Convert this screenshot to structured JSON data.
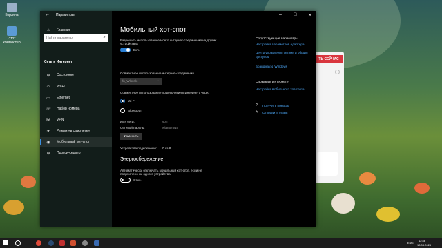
{
  "desktop": {
    "icons": [
      {
        "label": "Корзина",
        "color": "#9ab0c8"
      },
      {
        "label": "Этот компьютер",
        "color": "#5b9bd5"
      }
    ]
  },
  "background_window": {
    "button_label": "ТЬ СЕЙЧАС"
  },
  "window": {
    "title": "Параметры",
    "back_glyph": "←",
    "minimize_glyph": "–",
    "maximize_glyph": "□",
    "close_glyph": "✕"
  },
  "sidebar": {
    "home": "Главная",
    "search_placeholder": "Найти параметр",
    "section_header": "Сеть и Интернет",
    "items": [
      {
        "label": "Состояние",
        "icon": "⊕",
        "active": false
      },
      {
        "label": "Wi-Fi",
        "icon": "◠",
        "active": false
      },
      {
        "label": "Ethernet",
        "icon": "▭",
        "active": false
      },
      {
        "label": "Набор номера",
        "icon": "☏",
        "active": false
      },
      {
        "label": "VPN",
        "icon": "⋈",
        "active": false
      },
      {
        "label": "Режим «в самолете»",
        "icon": "✈",
        "active": false
      },
      {
        "label": "Мобильный хот-спот",
        "icon": "◉",
        "active": true
      },
      {
        "label": "Прокси-сервер",
        "icon": "⊕",
        "active": false
      }
    ]
  },
  "main": {
    "title": "Мобильный хот-спот",
    "share_desc_line1": "Разрешить использование моего интернет-соединения на других",
    "share_desc_line2": "устройствах",
    "share_toggle_label": "Вкл.",
    "share_from_label": "Совместное использование интернет-соединения",
    "share_from_value": "fn_Wlsuslo",
    "share_over_label": "Совместное использование подключения к Интернету через",
    "radio_wifi": "Wi-Fi",
    "radio_bluetooth": "Bluetooth",
    "network_name_label": "Имя сети:",
    "network_name_value": "vpn",
    "network_password_label": "Сетевой пароль:",
    "network_password_value": "wlan675w3",
    "change_button": "Изменить",
    "connected_label": "Устройства подключены:",
    "connected_value": "0 из 8",
    "power_section_title": "Энергосбережение",
    "power_desc_line1": "Автоматически отключать мобильный хот-спот, если не",
    "power_desc_line2": "подключено ни одного устройства.",
    "power_toggle_label": "Откл."
  },
  "right_panel": {
    "related_header": "Сопутствующие параметры",
    "links": [
      "Настройка параметров адаптера",
      "Центр управления сетями и общим",
      "доступом",
      "Брандмауэр Windows"
    ],
    "help_header": "Справка в Интернете",
    "help_link": "Настройка мобильного хот-спота",
    "get_help": "Получить помощь",
    "feedback": "Отправить отзыв"
  },
  "taskbar": {
    "time": "12:46",
    "date": "13.08.2024",
    "lang": "ENG"
  },
  "colors": {
    "accent": "#2a7fd4",
    "link": "#4ba3f0",
    "window_bg": "#000000"
  }
}
